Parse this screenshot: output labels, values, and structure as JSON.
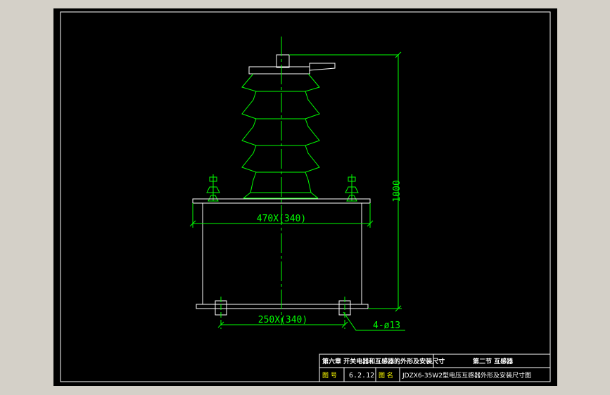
{
  "drawing": {
    "dim_height": "1000",
    "dim_top_width": "470X(340)",
    "dim_base_width": "250X(340)",
    "dim_holes": "4-ø13"
  },
  "title_block": {
    "chapter": "第六章  开关电器和互感器的外形及安装尺寸",
    "section": "第二节  互感器",
    "fig_no_label": "图  号",
    "fig_no": "6.2.12",
    "fig_name_label": "图  名",
    "fig_name": "JDZX6-35W2型电压互感器外形及安装尺寸图"
  },
  "colors": {
    "background": "#000000",
    "frame": "#ffffff",
    "insulator": "#00ff00",
    "dimension": "#00ff00",
    "body": "#ffffff",
    "centerline": "#00ff00",
    "workspace": "#d4d0c8"
  }
}
